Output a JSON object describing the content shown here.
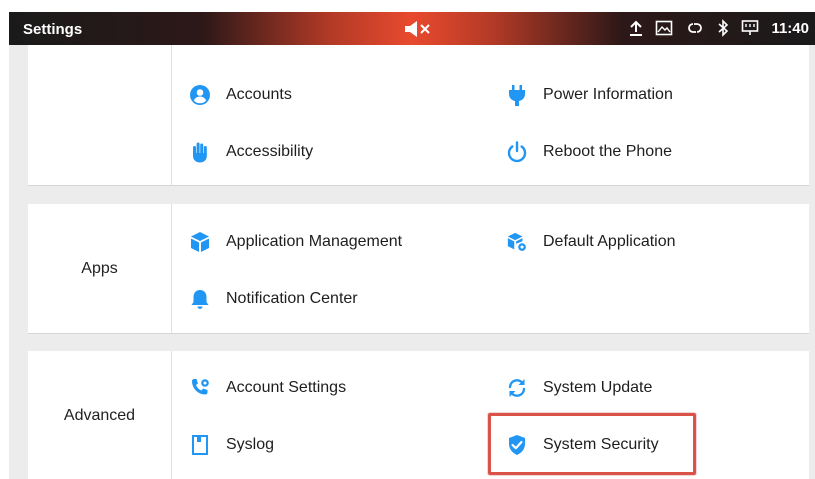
{
  "status_bar": {
    "title": "Settings",
    "time": "11:40",
    "icons": [
      "volume-muted-icon",
      "upload-icon",
      "image-icon",
      "link-icon",
      "bluetooth-icon",
      "ethernet-icon"
    ]
  },
  "colors": {
    "accent_blue": "#2196F3",
    "highlight_red": "#D9534A"
  },
  "sections": {
    "device": {
      "label": "",
      "items": [
        "Accounts",
        "Power Information",
        "Accessibility",
        "Reboot the Phone"
      ]
    },
    "apps": {
      "label": "Apps",
      "items": [
        "Application Management",
        "Default Application",
        "Notification Center"
      ]
    },
    "advanced": {
      "label": "Advanced",
      "items": [
        "Account Settings",
        "System Update",
        "Syslog",
        "System Security"
      ]
    }
  },
  "highlighted_item": "System Security"
}
